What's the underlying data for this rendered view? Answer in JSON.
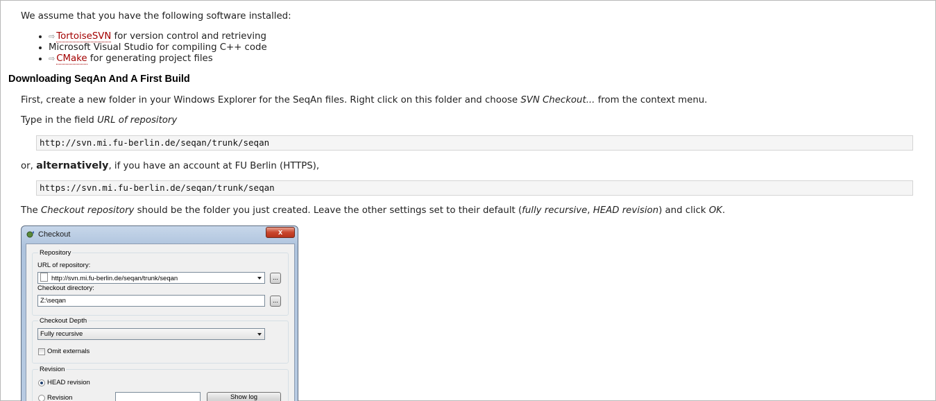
{
  "intro": "We assume that you have the following software installed:",
  "bullets": {
    "tortoise": {
      "arrow": "⇨",
      "link": "TortoiseSVN",
      "text": " for version control and retrieving"
    },
    "msvs": {
      "text": "Microsoft Visual Studio for compiling C++ code"
    },
    "cmake": {
      "arrow": "⇨",
      "link": "CMake",
      "text": " for generating project files"
    }
  },
  "section_title": "Downloading SeqAn And A First Build",
  "p1": {
    "pre": "First, create a new folder in your Windows Explorer for the SeqAn files. Right click on this folder and choose ",
    "em": "SVN Checkout...",
    "post": " from the context menu."
  },
  "p2": {
    "pre": "Type in the field ",
    "em": "URL of repository"
  },
  "code1": "http://svn.mi.fu-berlin.de/seqan/trunk/seqan",
  "p3": {
    "pre": "or, ",
    "strong": "alternatively",
    "post": ", if you have an account at FU Berlin (HTTPS),"
  },
  "code2": "https://svn.mi.fu-berlin.de/seqan/trunk/seqan",
  "p4": {
    "a": "The ",
    "em1": "Checkout repository",
    "b": " should be the folder you just created. Leave the other settings set to their default (",
    "em2": "fully recursive",
    "c": ", ",
    "em3": "HEAD revision",
    "d": ") and click ",
    "em4": "OK",
    "e": "."
  },
  "dialog": {
    "title": "Checkout",
    "close": "x",
    "repository_group": "Repository",
    "url_label": "URL of repository:",
    "url_value": "http://svn.mi.fu-berlin.de/seqan/trunk/seqan",
    "browse1": "...",
    "dir_label": "Checkout directory:",
    "dir_value": "Z:\\seqan",
    "browse2": "...",
    "depth_group": "Checkout Depth",
    "depth_value": "Fully recursive",
    "omit_externals": "Omit externals",
    "revision_group": "Revision",
    "head_revision": "HEAD revision",
    "revision": "Revision",
    "show_log": "Show log"
  },
  "colors": {
    "link": "#a30000",
    "code_bg": "#f5f5f5",
    "text": "#222222"
  }
}
